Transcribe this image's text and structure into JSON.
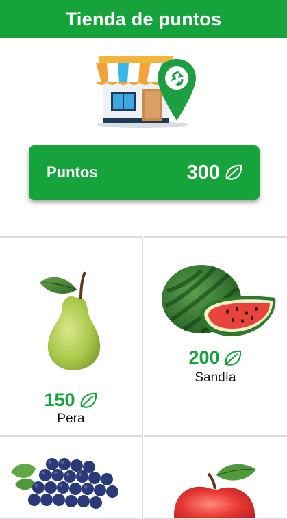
{
  "header": {
    "title": "Tienda de puntos"
  },
  "illustration": {
    "icon": "store-recycle-icon"
  },
  "points": {
    "label": "Puntos",
    "value": "300",
    "icon": "leaf-icon"
  },
  "products": [
    {
      "name": "Pera",
      "price": "150",
      "image": "pear-image"
    },
    {
      "name": "Sandía",
      "price": "200",
      "image": "watermelon-image"
    },
    {
      "name": "",
      "price": "",
      "image": "grapes-image"
    },
    {
      "name": "",
      "price": "",
      "image": "apple-image"
    }
  ],
  "colors": {
    "primary": "#16a33b",
    "divider": "#dcdcdc"
  }
}
